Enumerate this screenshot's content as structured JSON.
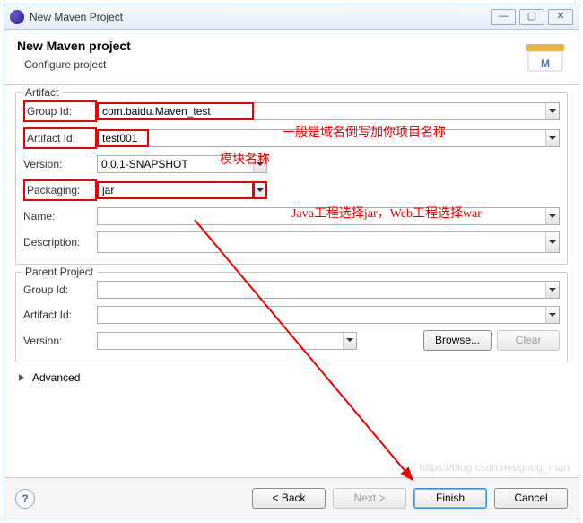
{
  "titlebar": {
    "title": "New Maven Project"
  },
  "header": {
    "title": "New Maven project",
    "subtitle": "Configure project"
  },
  "artifact": {
    "legend": "Artifact",
    "groupId_label": "Group Id:",
    "groupId": "com.baidu.Maven_test",
    "artifactId_label": "Artifact Id:",
    "artifactId": "test001",
    "version_label": "Version:",
    "version": "0.0.1-SNAPSHOT",
    "packaging_label": "Packaging:",
    "packaging": "jar",
    "name_label": "Name:",
    "name": "",
    "description_label": "Description:",
    "description": ""
  },
  "parent": {
    "legend": "Parent Project",
    "groupId_label": "Group Id:",
    "groupId": "",
    "artifactId_label": "Artifact Id:",
    "artifactId": "",
    "version_label": "Version:",
    "version": "",
    "browse": "Browse...",
    "clear": "Clear"
  },
  "advanced_label": "Advanced",
  "footer": {
    "back": "< Back",
    "next": "Next >",
    "finish": "Finish",
    "cancel": "Cancel"
  },
  "annotations": {
    "a1": "一般是域名倒写加你项目名称",
    "a2": "模块名称",
    "a3": "Java工程选择jar，Web工程选择war"
  },
  "watermark": "https://blog.csdn.net/goog_man"
}
